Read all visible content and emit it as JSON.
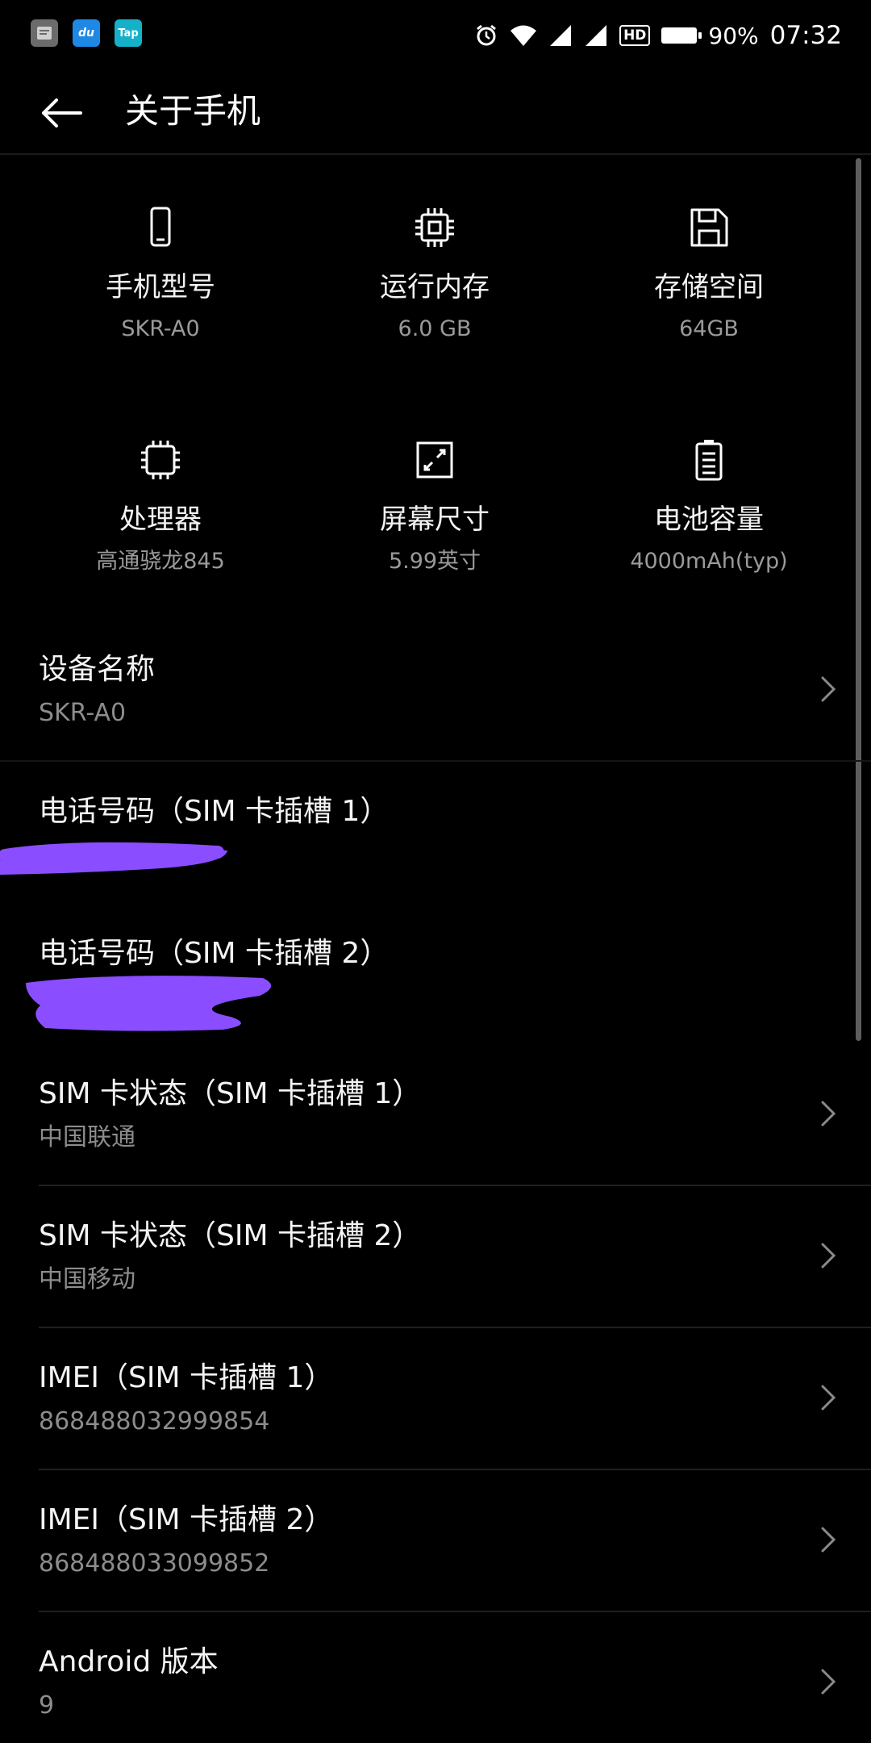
{
  "status_bar": {
    "apps": [
      {
        "icon": "notes-app-icon",
        "text": "",
        "color": "#6b6b6b"
      },
      {
        "icon": "du-app-icon",
        "text": "du",
        "color": "#1e88e5"
      },
      {
        "icon": "tap-app-icon",
        "text": "Tap",
        "color": "#14b1c8"
      }
    ],
    "hd_label": "HD",
    "battery_percent": "90%",
    "time": "07:32"
  },
  "app_bar": {
    "title": "关于手机",
    "back_icon": "back-arrow-icon"
  },
  "specs": [
    {
      "icon": "phone-icon",
      "label": "手机型号",
      "value": "SKR-A0"
    },
    {
      "icon": "memory-chip-icon",
      "label": "运行内存",
      "value": "6.0 GB"
    },
    {
      "icon": "floppy-save-icon",
      "label": "存储空间",
      "value": "64GB"
    },
    {
      "icon": "processor-icon",
      "label": "处理器",
      "value": "高通骁龙845"
    },
    {
      "icon": "screen-size-icon",
      "label": "屏幕尺寸",
      "value": "5.99英寸"
    },
    {
      "icon": "battery-icon",
      "label": "电池容量",
      "value": "4000mAh(typ)"
    }
  ],
  "list": [
    {
      "title": "设备名称",
      "subtitle": "SKR-A0",
      "chevron": true
    },
    {
      "title": "电话号码（SIM 卡插槽 1）",
      "subtitle": "",
      "chevron": false
    },
    {
      "title": "电话号码（SIM 卡插槽 2）",
      "subtitle": "",
      "chevron": false
    },
    {
      "title": "SIM 卡状态（SIM 卡插槽 1）",
      "subtitle": "中国联通",
      "chevron": true
    },
    {
      "title": "SIM 卡状态（SIM 卡插槽 2）",
      "subtitle": "中国移动",
      "chevron": true
    },
    {
      "title": "IMEI（SIM 卡插槽 1）",
      "subtitle": "868488032999854",
      "chevron": true
    },
    {
      "title": "IMEI（SIM 卡插槽 2）",
      "subtitle": "868488033099852",
      "chevron": true
    },
    {
      "title": "Android 版本",
      "subtitle": "9",
      "chevron": true
    }
  ],
  "colors": {
    "background": "#000000",
    "text_primary": "#f4f4f4",
    "text_secondary": "#8c8c8c",
    "redaction": "#8a4dff"
  }
}
